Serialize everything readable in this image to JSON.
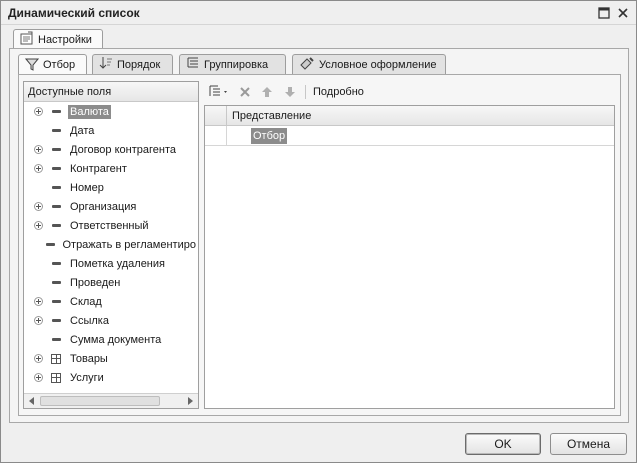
{
  "window": {
    "title": "Динамический список"
  },
  "outer_tab": {
    "label": "Настройки"
  },
  "tabs": [
    {
      "label": "Отбор",
      "active": true
    },
    {
      "label": "Порядок",
      "active": false
    },
    {
      "label": "Группировка",
      "active": false
    },
    {
      "label": "Условное оформление",
      "active": false
    }
  ],
  "fields": {
    "header": "Доступные поля",
    "items": [
      {
        "label": "Валюта",
        "expandable": true,
        "icon": "field-icon",
        "selected": true
      },
      {
        "label": "Дата",
        "expandable": false,
        "icon": "field-icon"
      },
      {
        "label": "Договор контрагента",
        "expandable": true,
        "icon": "field-icon"
      },
      {
        "label": "Контрагент",
        "expandable": true,
        "icon": "field-icon"
      },
      {
        "label": "Номер",
        "expandable": false,
        "icon": "field-icon"
      },
      {
        "label": "Организация",
        "expandable": true,
        "icon": "field-icon"
      },
      {
        "label": "Ответственный",
        "expandable": true,
        "icon": "field-icon"
      },
      {
        "label": "Отражать в регламентиро",
        "expandable": false,
        "icon": "field-icon"
      },
      {
        "label": "Пометка удаления",
        "expandable": false,
        "icon": "field-icon"
      },
      {
        "label": "Проведен",
        "expandable": false,
        "icon": "field-icon"
      },
      {
        "label": "Склад",
        "expandable": true,
        "icon": "field-icon"
      },
      {
        "label": "Ссылка",
        "expandable": true,
        "icon": "field-icon"
      },
      {
        "label": "Сумма документа",
        "expandable": false,
        "icon": "field-icon"
      },
      {
        "label": "Товары",
        "expandable": true,
        "icon": "table-icon"
      },
      {
        "label": "Услуги",
        "expandable": true,
        "icon": "table-icon"
      }
    ]
  },
  "toolbar": {
    "details_label": "Подробно"
  },
  "grid": {
    "column_header": "Представление",
    "rows": [
      {
        "label": "Отбор"
      }
    ]
  },
  "buttons": {
    "ok": "OK",
    "cancel": "Отмена"
  }
}
